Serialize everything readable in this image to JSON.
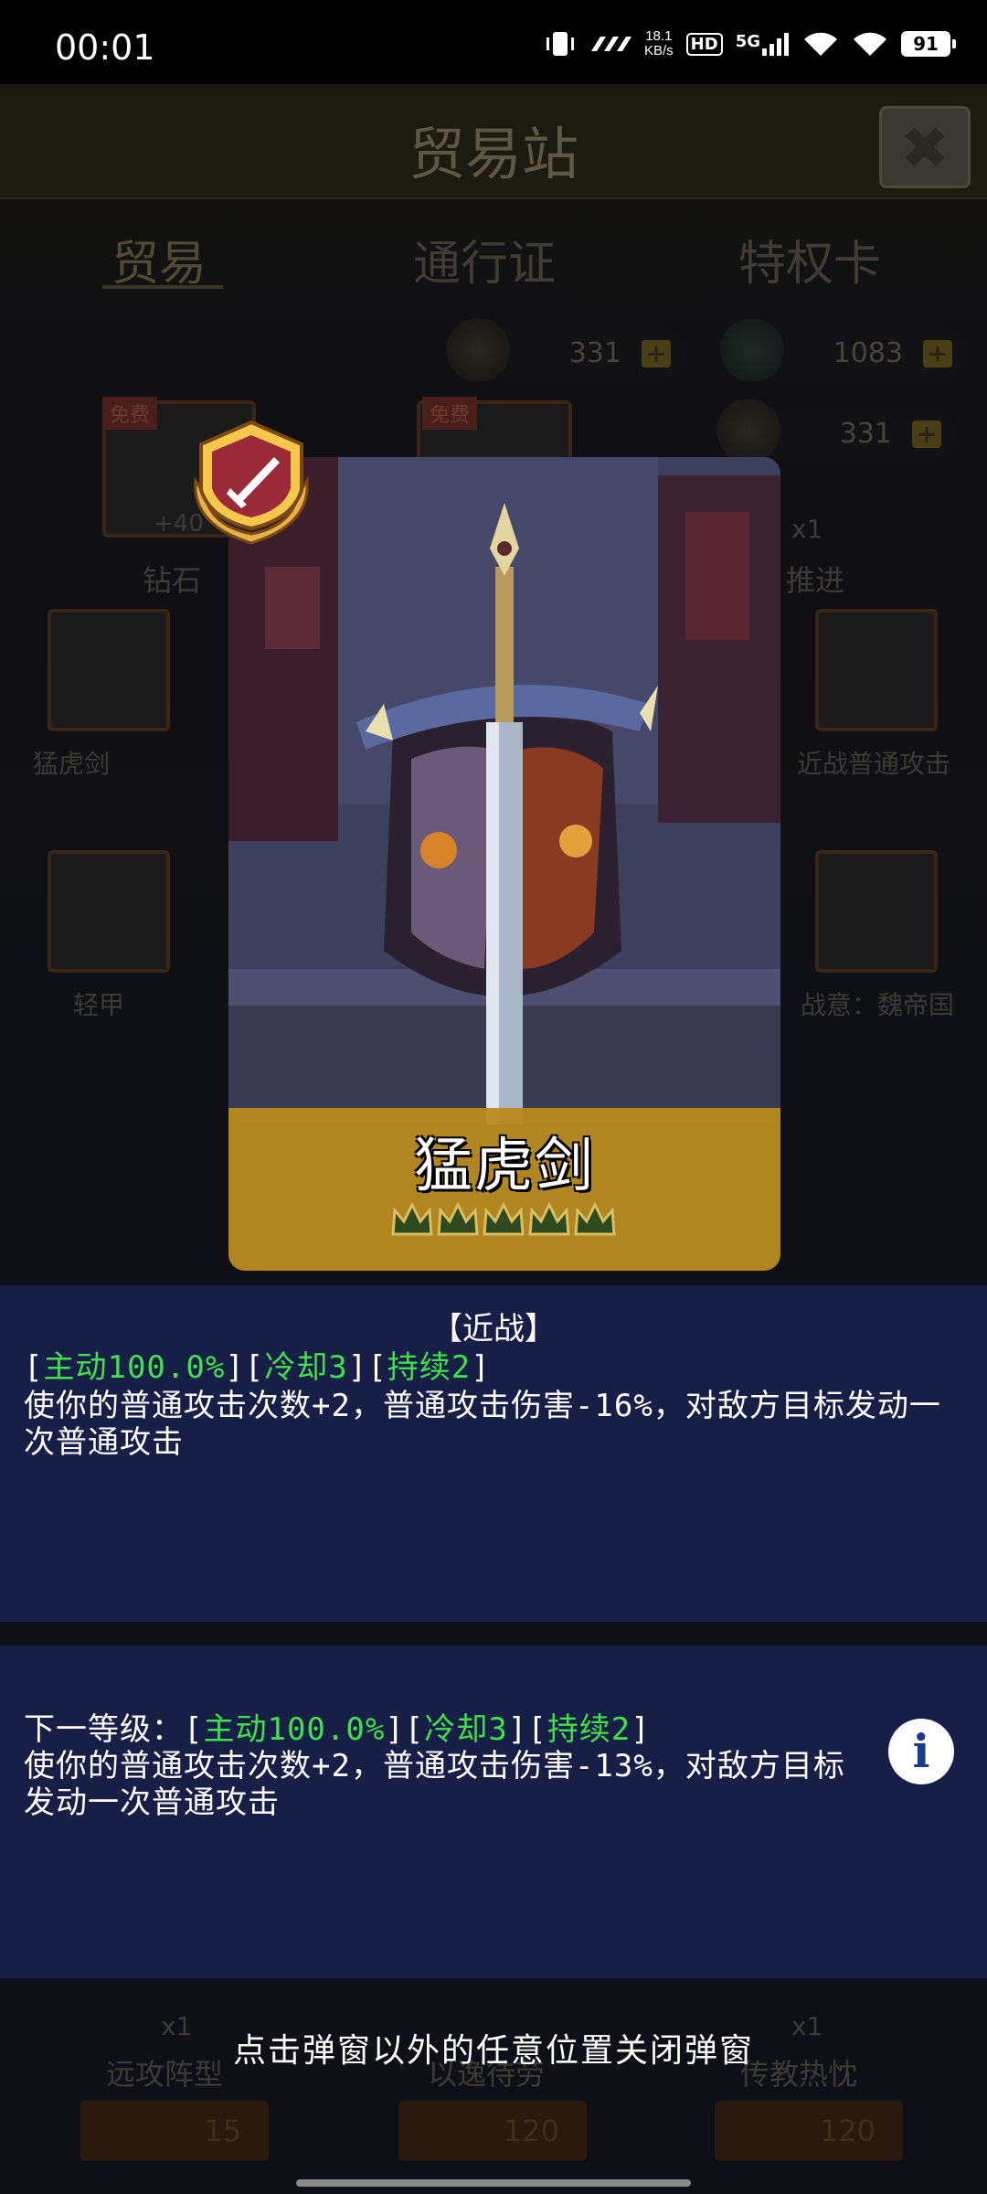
{
  "status_bar": {
    "time": "00:01",
    "net_speed_value": "18.1",
    "net_speed_unit": "KB/s",
    "hd_label": "HD",
    "network_label": "5G",
    "battery_level": "91"
  },
  "game": {
    "title": "贸易站",
    "tabs": [
      "贸易",
      "通行证",
      "特权卡"
    ],
    "currency": {
      "medal_1": "331",
      "gem": "1083",
      "medal_2": "331"
    },
    "free_tags": [
      "免费",
      "免费"
    ],
    "tile_labels": [
      "钻石",
      "猛虎剑",
      "轻甲",
      "推进",
      "近战普通攻击",
      "战意：魏帝国",
      "远攻阵型",
      "以逸待劳",
      "传教热忱"
    ],
    "tile_counts": [
      "+40",
      "x1",
      "x1",
      "x1",
      "x1"
    ],
    "prices": [
      "15",
      "120",
      "120"
    ]
  },
  "card": {
    "name": "猛虎剑",
    "stars": 5,
    "badge_icon": "sword-emblem-icon"
  },
  "skill_current": {
    "category": "【近战】",
    "tags": [
      "主动100.0%",
      "冷却3",
      "持续2"
    ],
    "description": "使你的普通攻击次数+2，普通攻击伤害-16%，对敌方目标发动一次普通攻击"
  },
  "skill_next": {
    "prefix": "下一等级：",
    "tags": [
      "主动100.0%",
      "冷却3",
      "持续2"
    ],
    "description": "使你的普通攻击次数+2，普通攻击伤害-13%，对敌方目标发动一次普通攻击"
  },
  "hint": "点击弹窗以外的任意位置关闭弹窗",
  "colors": {
    "highlight_green": "#3ee24a",
    "panel_blue": "#18204a",
    "name_gold": "#b88a1f"
  }
}
